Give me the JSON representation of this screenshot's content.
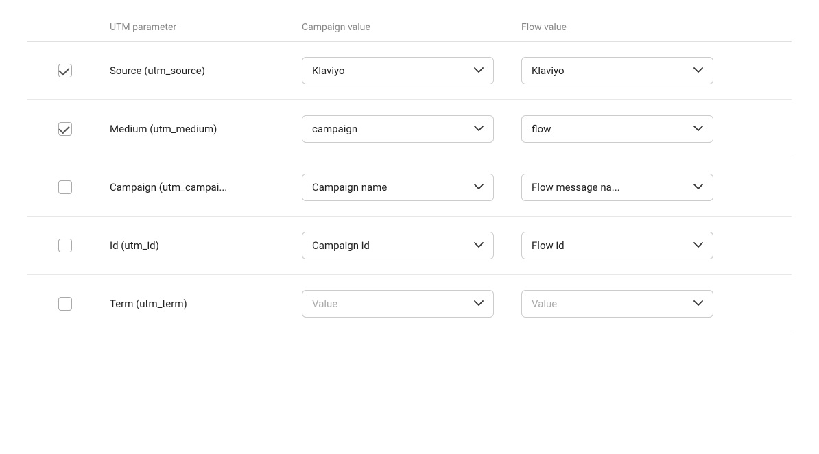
{
  "headers": {
    "utm_param": "UTM parameter",
    "campaign_value": "Campaign value",
    "flow_value": "Flow value"
  },
  "rows": [
    {
      "id": "source",
      "checked": true,
      "label": "Source (utm_source)",
      "campaign_dropdown": {
        "value": "Klaviyo",
        "placeholder": false
      },
      "flow_dropdown": {
        "value": "Klaviyo",
        "placeholder": false
      }
    },
    {
      "id": "medium",
      "checked": true,
      "label": "Medium (utm_medium)",
      "campaign_dropdown": {
        "value": "campaign",
        "placeholder": false
      },
      "flow_dropdown": {
        "value": "flow",
        "placeholder": false
      }
    },
    {
      "id": "campaign",
      "checked": false,
      "label": "Campaign (utm_campai...",
      "campaign_dropdown": {
        "value": "Campaign name",
        "placeholder": false
      },
      "flow_dropdown": {
        "value": "Flow message na...",
        "placeholder": false
      }
    },
    {
      "id": "id",
      "checked": false,
      "label": "Id (utm_id)",
      "campaign_dropdown": {
        "value": "Campaign id",
        "placeholder": false
      },
      "flow_dropdown": {
        "value": "Flow id",
        "placeholder": false
      }
    },
    {
      "id": "term",
      "checked": false,
      "label": "Term (utm_term)",
      "campaign_dropdown": {
        "value": "Value",
        "placeholder": true
      },
      "flow_dropdown": {
        "value": "Value",
        "placeholder": true
      }
    }
  ],
  "chevron_down": "❯"
}
